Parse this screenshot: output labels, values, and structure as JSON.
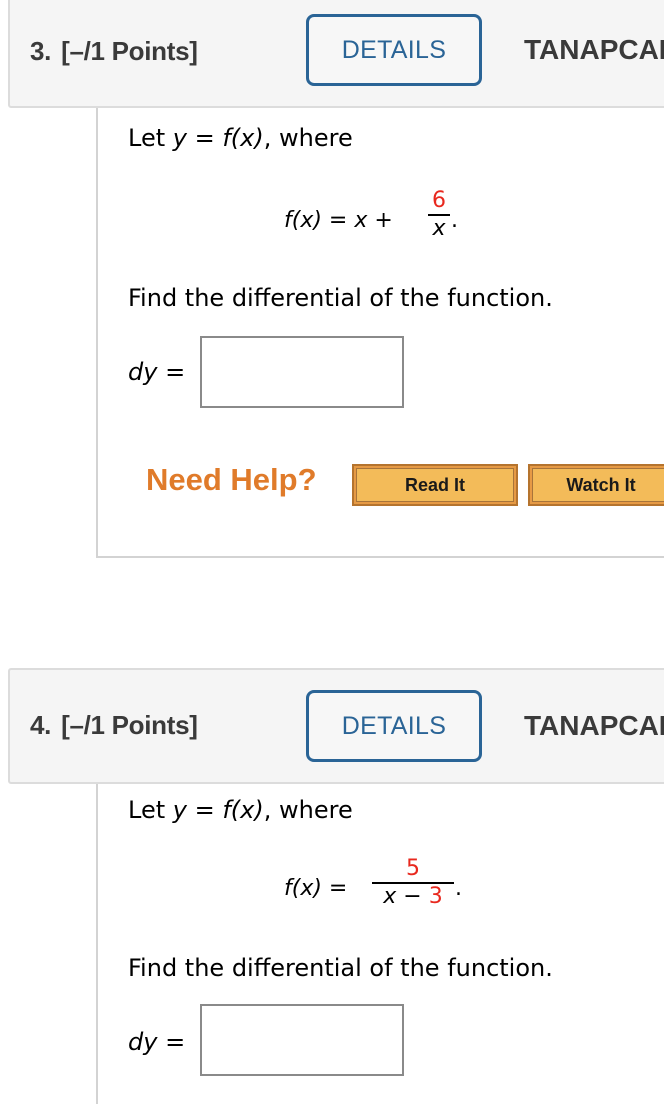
{
  "questions": [
    {
      "number": "3.",
      "points": "[–/1 Points]",
      "details_label": "DETAILS",
      "source": "TANAPCALC",
      "intro": {
        "prefix": "Let ",
        "y": "y",
        "eq": " = ",
        "fx": "f(x)",
        "suffix": ", where"
      },
      "formula": {
        "lhs": "f(x)",
        "eq": " = ",
        "term": "x",
        "plus": " + ",
        "numerator": "6",
        "denominator": "x",
        "end": "."
      },
      "prompt": "Find the differential of the function.",
      "answer_label": "dy",
      "answer_eq": " =",
      "answer_value": "",
      "help": {
        "label": "Need Help?",
        "read_it": "Read It",
        "watch_it": "Watch It"
      }
    },
    {
      "number": "4.",
      "points": "[–/1 Points]",
      "details_label": "DETAILS",
      "source": "TANAPCALC",
      "intro": {
        "prefix": "Let ",
        "y": "y",
        "eq": " = ",
        "fx": "f(x)",
        "suffix": ", where"
      },
      "formula": {
        "lhs": "f(x)",
        "eq": " = ",
        "numerator": "5",
        "den_var": "x",
        "den_op": " − ",
        "den_const": "3",
        "end": "."
      },
      "prompt": "Find the differential of the function.",
      "answer_label": "dy",
      "answer_eq": " =",
      "answer_value": ""
    }
  ],
  "colors": {
    "details_blue": "#2a6496",
    "coefficient_red": "#e8281e",
    "help_orange": "#e07b2a",
    "help_button_fill": "#f3bb59"
  }
}
